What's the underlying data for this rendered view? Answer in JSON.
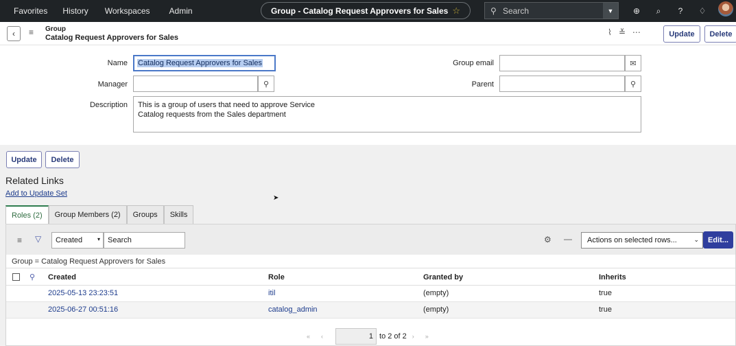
{
  "topnav": {
    "favorites": "Favorites",
    "history": "History",
    "workspaces": "Workspaces",
    "admin": "Admin",
    "record_title": "Group - Catalog Request Approvers for Sales",
    "search_placeholder": "Search"
  },
  "header": {
    "record_type": "Group",
    "record_name": "Catalog Request Approvers for Sales",
    "update_label": "Update",
    "delete_label": "Delete"
  },
  "form": {
    "name_label": "Name",
    "name_value": "Catalog Request Approvers for Sales",
    "group_email_label": "Group email",
    "group_email_value": "",
    "manager_label": "Manager",
    "manager_value": "",
    "parent_label": "Parent",
    "parent_value": "",
    "description_label": "Description",
    "description_value": "This is a group of users that need to approve Service\n            Catalog requests from the Sales department"
  },
  "bottom_buttons": {
    "update_label": "Update",
    "delete_label": "Delete"
  },
  "related_links": {
    "title": "Related Links",
    "add_to_update_set": "Add to Update Set"
  },
  "tabs": [
    {
      "label": "Roles (2)",
      "active": true
    },
    {
      "label": "Group Members (2)",
      "active": false
    },
    {
      "label": "Groups",
      "active": false
    },
    {
      "label": "Skills",
      "active": false
    }
  ],
  "list": {
    "field_select": "Created",
    "search_placeholder": "Search",
    "actions_select": "Actions on selected rows...",
    "edit_label": "Edit...",
    "breadcrumb": "Group = Catalog Request Approvers for Sales",
    "columns": [
      "Created",
      "Role",
      "Granted by",
      "Inherits"
    ],
    "rows": [
      {
        "created": "2025-05-13 23:23:51",
        "role": "itil",
        "granted_by": "(empty)",
        "inherits": "true"
      },
      {
        "created": "2025-06-27 00:51:16",
        "role": "catalog_admin",
        "granted_by": "(empty)",
        "inherits": "true"
      }
    ],
    "pager_current": "1",
    "pager_total": "to 2 of 2"
  },
  "colors": {
    "nav_bg": "#1f2326",
    "accent_green": "#2e7d4f",
    "link_blue": "#1c3b8c",
    "primary_button": "#2f3e9e"
  }
}
